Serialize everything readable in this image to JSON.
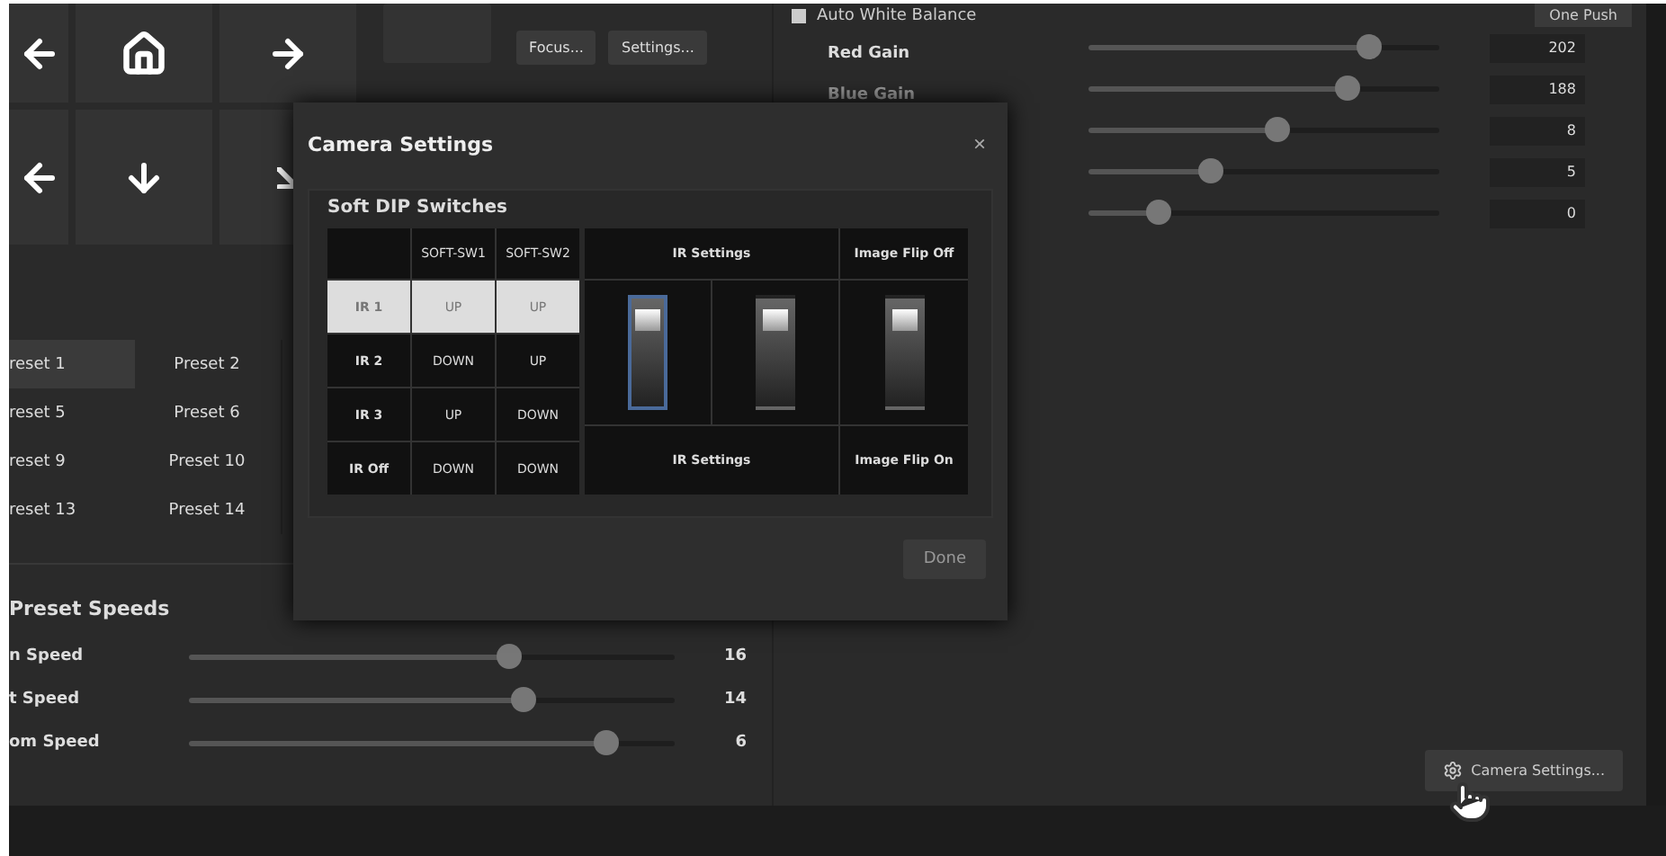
{
  "pad": {
    "cells": [
      {
        "kind": "left"
      },
      {
        "kind": "home"
      },
      {
        "kind": "right"
      },
      {
        "kind": "left"
      },
      {
        "kind": "down"
      },
      {
        "kind": "diagonal"
      }
    ],
    "buttons": [
      "Focus...",
      "Settings..."
    ]
  },
  "presets": [
    {
      "label": "reset 1",
      "selected": true
    },
    {
      "label": "Preset 2",
      "selected": false
    },
    {
      "label": "reset 5",
      "selected": false
    },
    {
      "label": "Preset 6",
      "selected": false
    },
    {
      "label": "reset 9",
      "selected": false
    },
    {
      "label": "Preset 10",
      "selected": false
    },
    {
      "label": "reset 13",
      "selected": false
    },
    {
      "label": "Preset 14",
      "selected": false
    }
  ],
  "preset_speeds": {
    "title": "Preset Speeds",
    "rows": [
      {
        "label": "n Speed",
        "level": 0.66,
        "value": "16"
      },
      {
        "label": "t Speed",
        "level": 0.69,
        "value": "14"
      },
      {
        "label": "om Speed",
        "level": 0.86,
        "value": "6"
      }
    ]
  },
  "white_balance": {
    "auto": {
      "label": "Auto White Balance",
      "checked": false
    },
    "one_push": "One Push",
    "rows": [
      {
        "label": "Red Gain",
        "disabled": false,
        "level": 0.8,
        "value": "202"
      },
      {
        "label": "Blue Gain",
        "disabled": true,
        "level": 0.74,
        "value": "188"
      },
      {
        "level": 0.54,
        "value": "8"
      },
      {
        "level": 0.35,
        "value": "5"
      },
      {
        "level": 0.2,
        "value": "0"
      }
    ]
  },
  "camera_settings_button": "Camera Settings...",
  "dialog": {
    "title": "Camera Settings",
    "close": "×",
    "section": "Soft DIP Switches",
    "table": {
      "columns": [
        "SOFT-SW1",
        "SOFT-SW2"
      ],
      "rows": [
        {
          "label": "IR 1",
          "sw1": "UP",
          "sw2": "UP",
          "selected": true
        },
        {
          "label": "IR 2",
          "sw1": "DOWN",
          "sw2": "UP",
          "selected": false
        },
        {
          "label": "IR 3",
          "sw1": "UP",
          "sw2": "DOWN",
          "selected": false
        },
        {
          "label": "IR Off",
          "sw1": "DOWN",
          "sw2": "DOWN",
          "selected": false
        }
      ]
    },
    "switch_panel": {
      "top_labels": [
        "IR Settings",
        "Image Flip Off"
      ],
      "switches": [
        {
          "selected": true
        },
        {
          "selected": false
        },
        {
          "selected": false
        }
      ],
      "bottom_labels": [
        "IR Settings",
        "Image Flip On"
      ]
    },
    "done": "Done"
  }
}
